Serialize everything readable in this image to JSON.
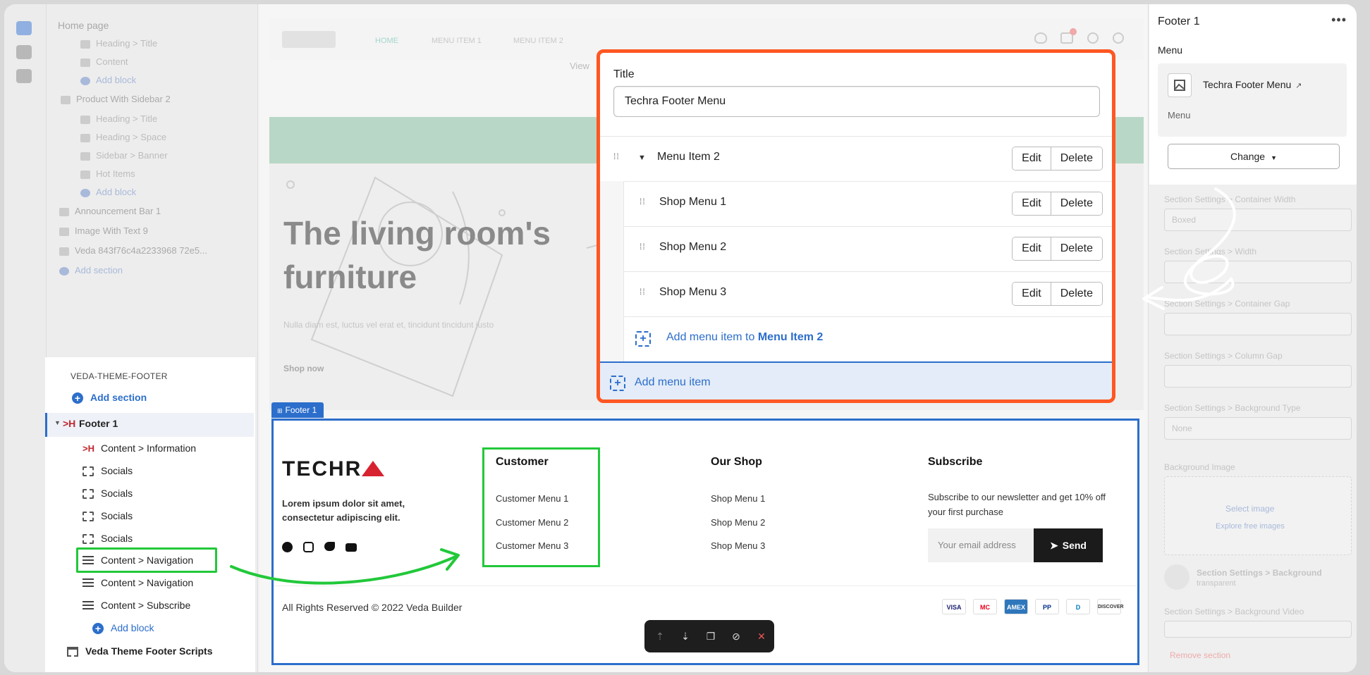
{
  "left_tree_bg": {
    "header": "Home page",
    "rows": [
      "Heading > Title",
      "Content",
      "Add block",
      "Product With Sidebar 2",
      "Heading > Title",
      "Heading > Space",
      "Sidebar > Banner",
      "Hot Items",
      "Add block",
      "Announcement Bar 1",
      "Image With Text 9",
      "Veda 843f76c4a2233968 72e5...",
      "Add section"
    ]
  },
  "site_bg": {
    "nav_items": [
      "HOME",
      "MENU ITEM 1",
      "MENU ITEM 2"
    ],
    "view_label": "View",
    "hero_title_line1": "The living room's",
    "hero_title_line2": "furniture",
    "hero_sub": "Nulla diam est, luctus vel erat et, tincidunt tincidunt justo",
    "shop_now": "Shop now"
  },
  "left_panel": {
    "group_label": "VEDA-THEME-FOOTER",
    "add_section": "Add section",
    "footer_item": "Footer 1",
    "children": [
      {
        "label": "Content > Information",
        "icon": "footer-icon"
      },
      {
        "label": "Socials",
        "icon": "dashed-box-icon"
      },
      {
        "label": "Socials",
        "icon": "dashed-box-icon"
      },
      {
        "label": "Socials",
        "icon": "dashed-box-icon"
      },
      {
        "label": "Socials",
        "icon": "dashed-box-icon"
      },
      {
        "label": "Content > Navigation",
        "icon": "lines-icon"
      },
      {
        "label": "Content > Navigation",
        "icon": "lines-icon"
      },
      {
        "label": "Content > Subscribe",
        "icon": "lines-icon"
      }
    ],
    "add_block": "Add block",
    "scripts_item": "Veda Theme Footer Scripts"
  },
  "footer": {
    "tag": "Footer 1",
    "logo": "TECHR",
    "about": "Lorem ipsum dolor sit amet, consectetur adipiscing elit.",
    "customer_heading": "Customer",
    "customer_links": [
      "Customer Menu 1",
      "Customer Menu 2",
      "Customer Menu 3"
    ],
    "shop_heading": "Our Shop",
    "shop_links": [
      "Shop Menu 1",
      "Shop Menu 2",
      "Shop Menu 3"
    ],
    "subscribe_heading": "Subscribe",
    "subscribe_text_1": "Subscribe to our newsletter and get 10% off",
    "subscribe_text_2": "your first purchase",
    "email_placeholder": "Your email address",
    "send_label": "Send",
    "copyright": "All Rights Reserved © 2022 Veda Builder",
    "payments": [
      "VISA",
      "MC",
      "AMEX",
      "PP",
      "D",
      "DISCOVER"
    ]
  },
  "modal": {
    "title_label": "Title",
    "title_value": "Techra Footer Menu",
    "parent_item": "Menu Item 2",
    "children": [
      "Shop Menu 1",
      "Shop Menu 2",
      "Shop Menu 3"
    ],
    "edit_label": "Edit",
    "delete_label": "Delete",
    "add_child_prefix": "Add menu item to ",
    "add_child_target": "Menu Item 2",
    "add_item": "Add menu item"
  },
  "right_popover": {
    "title": "Footer 1",
    "menu_label": "Menu",
    "menu_name": "Techra Footer Menu",
    "menu_sub": "Menu",
    "change_label": "Change"
  },
  "right_bg": {
    "labels": [
      "Section Settings > Container Width",
      "Section Settings > Width",
      "Section Settings > Container Gap",
      "Section Settings > Column Gap",
      "Section Settings > Background Type",
      "Background Image",
      "Select image",
      "Explore free images",
      "Section Settings > Background",
      "transparent",
      "Section Settings > Background Video",
      "Remove section"
    ],
    "select_value_1": "Boxed",
    "select_value_2": "None"
  },
  "colors": {
    "accent": "#2c6ecb",
    "highlight_green": "#22c83a",
    "modal_border": "#ff5722",
    "logo_red": "#d7232f"
  }
}
